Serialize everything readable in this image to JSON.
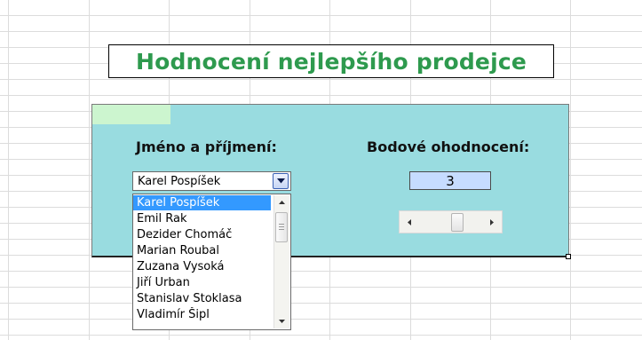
{
  "sheet": {
    "title": "Hodnocení nejlepšího prodejce",
    "title_color": "#2e9a4e",
    "panel_color": "#99dce0"
  },
  "form": {
    "name_label": "Jméno a příjmení:",
    "score_label": "Bodové ohodnocení:",
    "combo": {
      "selected": "Karel Pospíšek",
      "dropdown_icon": "chevron-down-icon"
    },
    "list_items": [
      "Karel Pospíšek",
      "Emil Rak",
      "Dezider Chomáč",
      "Marian Roubal",
      "Zuzana Vysoká",
      "Jiří Urban",
      "Stanislav Stoklasa",
      "Vladimír Šipl"
    ],
    "selected_index": 0,
    "score_value": "3",
    "slider": {
      "min": 0,
      "max": 5,
      "value": 3
    }
  }
}
